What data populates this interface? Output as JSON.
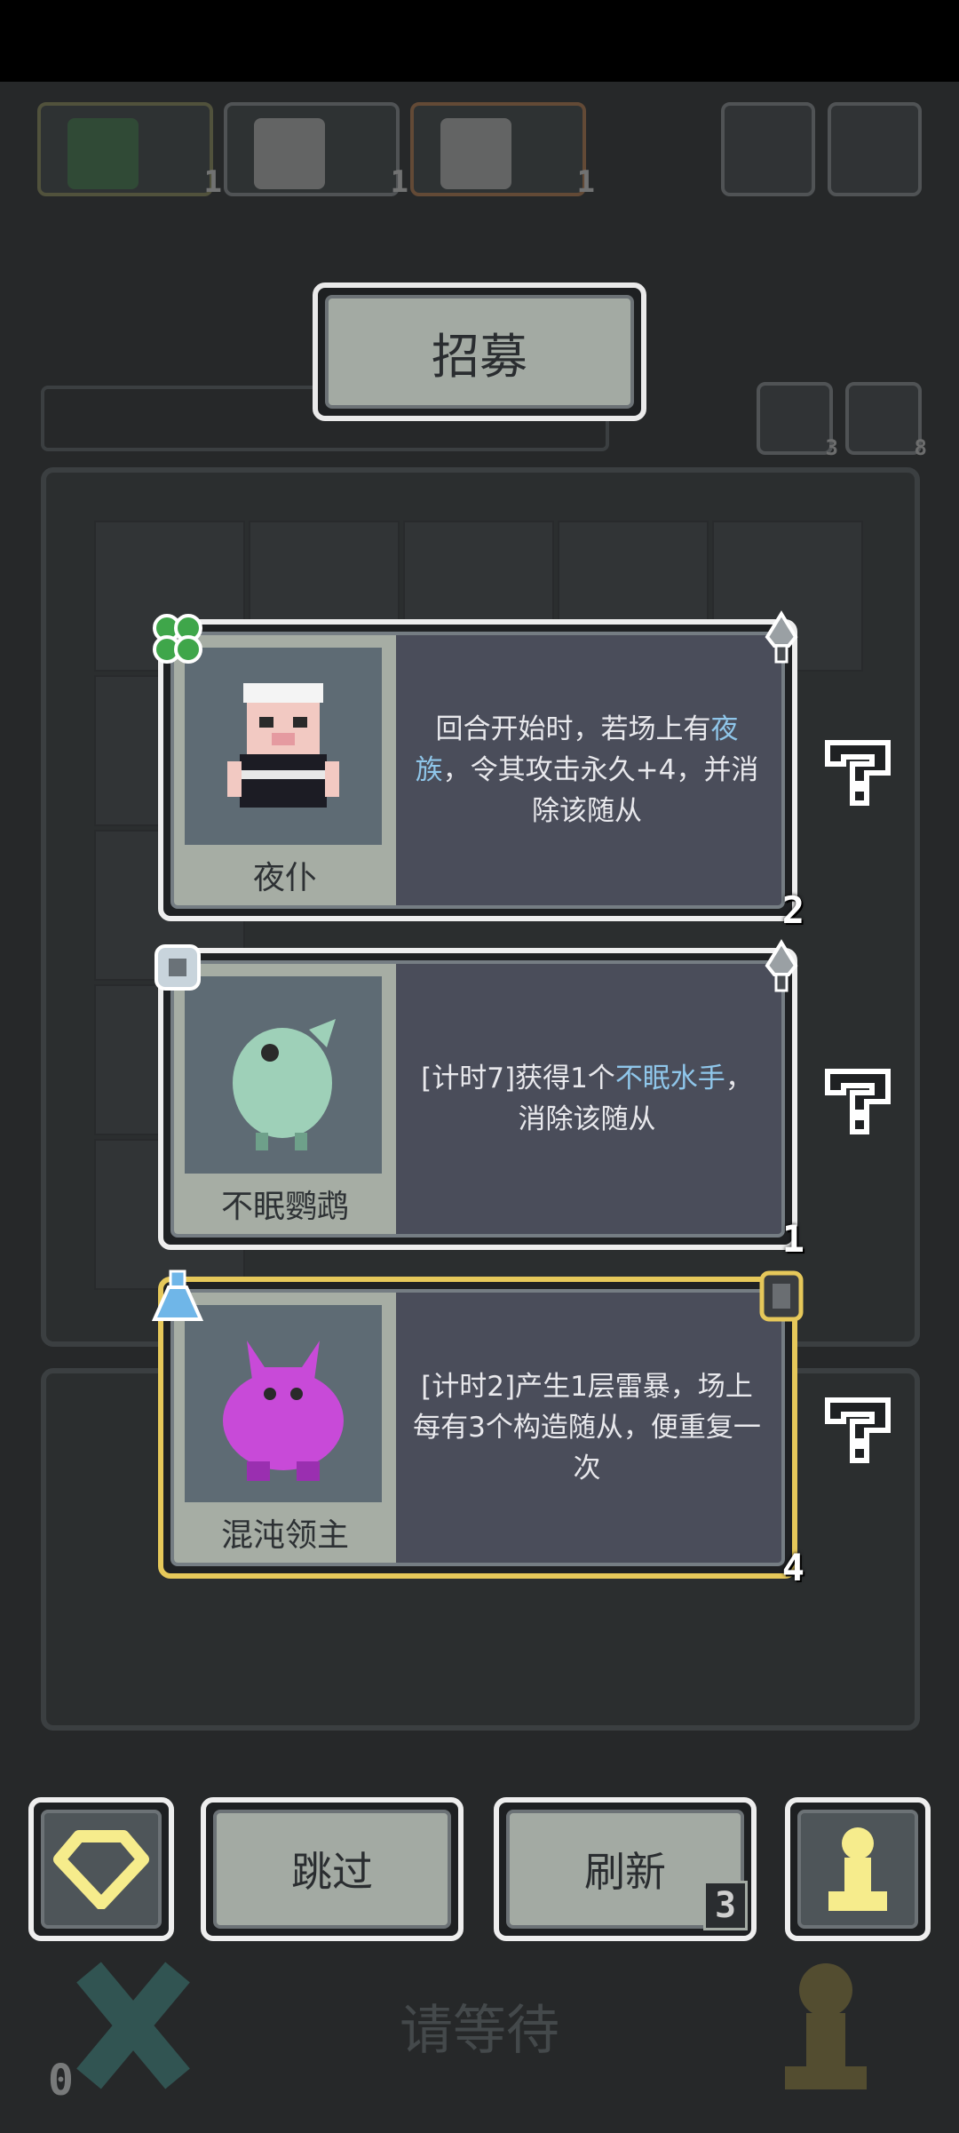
{
  "top_bar": {
    "slots": [
      {
        "count": "1",
        "color": "#3f7a4a"
      },
      {
        "count": "1",
        "color": "#c8c8c8"
      },
      {
        "count": "1",
        "color": "#c8c8c8"
      }
    ],
    "help_icon": "question-icon",
    "settings_icon": "gear-icon"
  },
  "recruit": {
    "title": "招募"
  },
  "side_counters": {
    "undo_count": "3",
    "pawn_count": "8"
  },
  "cards": [
    {
      "name": "夜仆",
      "desc_before": "回合开始时，若场上有",
      "desc_highlight": "夜族",
      "desc_after": "，令其攻击永久+4，并消除该随从",
      "number": "2",
      "left_badge": "clover-icon",
      "right_badge": "sword-icon",
      "border": "#eeeeee"
    },
    {
      "name": "不眠鹦鹉",
      "desc_before": "[计时7]获得1个",
      "desc_highlight": "不眠水手",
      "desc_after": "，消除该随从",
      "number": "1",
      "left_badge": "bone-icon",
      "right_badge": "sword-icon",
      "border": "#eeeeee"
    },
    {
      "name": "混沌领主",
      "desc_before": "[计时2]产生1层雷暴，场上每有3个构造随从，便重复一次",
      "desc_highlight": "",
      "desc_after": "",
      "number": "4",
      "left_badge": "flask-icon",
      "right_badge": "shield-icon",
      "border": "#e6c85a"
    }
  ],
  "actions": {
    "skip": "跳过",
    "refresh": "刷新",
    "refresh_count": "3",
    "gem_icon": "gem-icon",
    "pawn_icon": "pawn-icon"
  },
  "background": {
    "wait_text": "请等待",
    "zero_count": "0"
  },
  "colors": {
    "highlight": "#8fc6ea",
    "gold": "#e6c85a",
    "yellow": "#f6ec8c"
  }
}
